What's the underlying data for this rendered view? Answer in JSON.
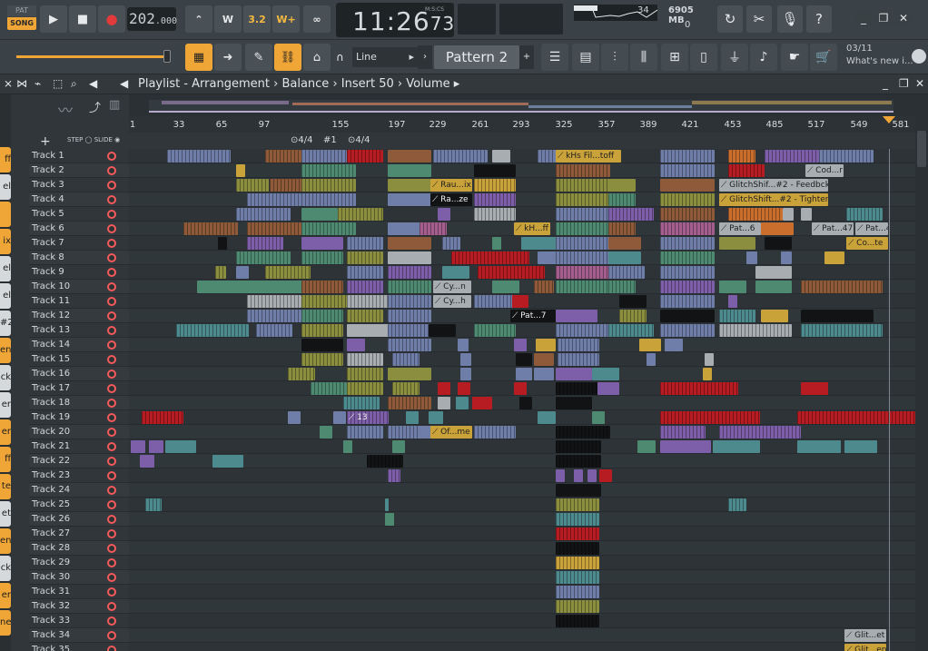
{
  "transport": {
    "pat_label": "PAT",
    "song_label": "SONG",
    "play_icon": "play-icon",
    "stop_icon": "stop-icon",
    "record_icon": "record-icon",
    "tempo_int": "202",
    "tempo_dec": ".000"
  },
  "clock": {
    "time": "11:26",
    "cs": "73",
    "mode_label": "M:S:CS"
  },
  "monitor": {
    "cpu": "34",
    "memory": "6905 MB",
    "polyphony": "0"
  },
  "toolbar": {
    "snap_value": "Line",
    "pattern_name": "Pattern 2",
    "news_date": "03/11",
    "news_text": "What's new i..."
  },
  "playlist": {
    "title": "Playlist - Arrangement",
    "breadcrumb_sep": "›",
    "crumb1": "Balance",
    "crumb2": "Insert 50",
    "crumb3": "Volume",
    "step_label": "STEP",
    "slide_label": "SLIDE",
    "add_label": "+"
  },
  "ruler_marks": [
    "1",
    "33",
    "65",
    "97",
    "155",
    "197",
    "229",
    "261",
    "293",
    "325",
    "357",
    "389",
    "421",
    "453",
    "485",
    "517",
    "549",
    "581"
  ],
  "markers": [
    "4/4",
    "1",
    "4/4"
  ],
  "left_strip": [
    {
      "label": "ff",
      "color": "#f0a636"
    },
    {
      "label": "el",
      "color": "#d6d9db"
    },
    {
      "label": "",
      "color": "#f0a636"
    },
    {
      "label": "ix",
      "color": "#f0a636"
    },
    {
      "label": "el",
      "color": "#d6d9db"
    },
    {
      "label": "el",
      "color": "#d6d9db"
    },
    {
      "label": "#2",
      "color": "#d6d9db"
    },
    {
      "label": "en",
      "color": "#f0a636"
    },
    {
      "label": "ck",
      "color": "#d6d9db"
    },
    {
      "label": "er",
      "color": "#d6d9db"
    },
    {
      "label": "er",
      "color": "#f0a636"
    },
    {
      "label": "ff",
      "color": "#f0a636"
    },
    {
      "label": "te",
      "color": "#f0a636"
    },
    {
      "label": "et",
      "color": "#d6d9db"
    },
    {
      "label": "en",
      "color": "#f0a636"
    },
    {
      "label": "ck",
      "color": "#d6d9db"
    },
    {
      "label": "er",
      "color": "#f0a636"
    },
    {
      "label": "ne",
      "color": "#f0a636"
    }
  ],
  "tracks": [
    "Track 1",
    "Track 2",
    "Track 3",
    "Track 4",
    "Track 5",
    "Track 6",
    "Track 7",
    "Track 8",
    "Track 9",
    "Track 10",
    "Track 11",
    "Track 12",
    "Track 13",
    "Track 14",
    "Track 15",
    "Track 16",
    "Track 17",
    "Track 18",
    "Track 19",
    "Track 20",
    "Track 21",
    "Track 22",
    "Track 23",
    "Track 24",
    "Track 25",
    "Track 26",
    "Track 27",
    "Track 28",
    "Track 29",
    "Track 30",
    "Track 31",
    "Track 32",
    "Track 33",
    "Track 34",
    "Track 35"
  ],
  "clip_labels": {
    "t1": "kHs Fil...toff",
    "t2": "Cod...r",
    "t3a": "Rau...ix",
    "t3b": "GlitchShif...#2 - Feedbck",
    "t4a": "Ra...ze",
    "t4b": "GlitchShift...#2 - Tighten",
    "t6a": "kH...ff",
    "t6b": "Pat...6",
    "t6c": "Pat...47",
    "t6d": "Pat...47",
    "t7": "Co...te",
    "t10": "Cy...n",
    "t11": "Cy...h",
    "t12": "Pat...7",
    "t19": "13",
    "t20": "Of...me",
    "t34": "Glit...et",
    "t35": "Glit...en"
  },
  "colors": {
    "accent": "#f0a636",
    "bg": "#2b3135",
    "red_clip": "#b71c22",
    "blue_clip": "#6f7ea8",
    "green_clip": "#4e8a72",
    "purple_clip": "#7d5ea8",
    "olive_clip": "#8a8e3e",
    "brown_clip": "#8e5a3a"
  }
}
